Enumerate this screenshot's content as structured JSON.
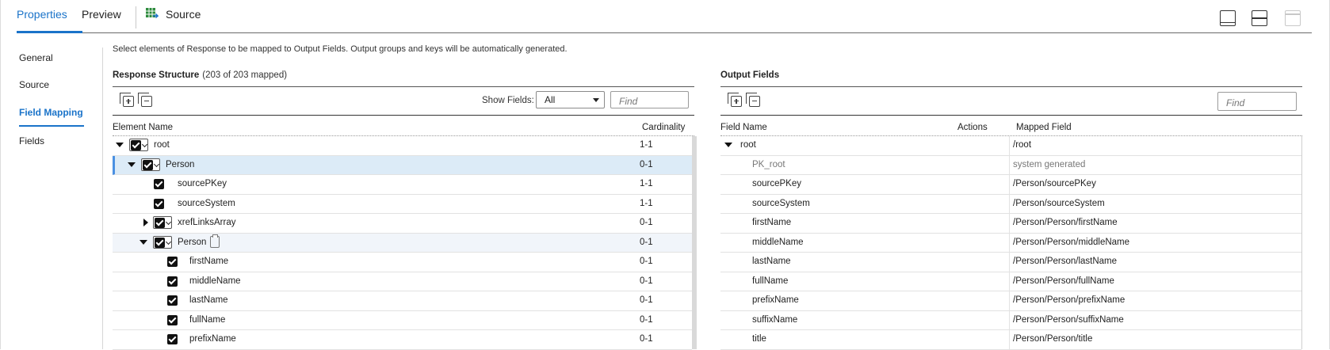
{
  "tabs": [
    {
      "label": "Properties",
      "active": true
    },
    {
      "label": "Preview",
      "active": false
    },
    {
      "label": "Source",
      "active": false
    }
  ],
  "layout_icons": [
    "bottom-panel-icon",
    "split-panel-icon",
    "top-panel-icon"
  ],
  "nav": {
    "items": [
      {
        "label": "General",
        "active": false
      },
      {
        "label": "Source",
        "active": false
      },
      {
        "label": "Field Mapping",
        "active": true
      },
      {
        "label": "Fields",
        "active": false
      }
    ]
  },
  "instruction": "Select elements of Response to be mapped to Output Fields. Output groups and keys will be automatically generated.",
  "response": {
    "title": "Response Structure",
    "mapped": "(203 of 203 mapped)",
    "show_fields_label": "Show Fields:",
    "show_fields_value": "All",
    "find_placeholder": "Find",
    "col_element": "Element Name",
    "col_cardinality": "Cardinality",
    "rows": [
      {
        "name": "root",
        "cardinality": "1-1",
        "level": 0,
        "expander": "down",
        "combo": true
      },
      {
        "name": "Person",
        "cardinality": "0-1",
        "level": 1,
        "expander": "down",
        "combo": true,
        "selected": true
      },
      {
        "name": "sourcePKey",
        "cardinality": "1-1",
        "level": 2,
        "expander": "none",
        "combo": false
      },
      {
        "name": "sourceSystem",
        "cardinality": "1-1",
        "level": 2,
        "expander": "none",
        "combo": false
      },
      {
        "name": "xrefLinksArray",
        "cardinality": "0-1",
        "level": 2,
        "expander": "right",
        "combo": true
      },
      {
        "name": "Person",
        "cardinality": "0-1",
        "level": 2,
        "expander": "down",
        "combo": true,
        "clip": true,
        "hover": true
      },
      {
        "name": "firstName",
        "cardinality": "0-1",
        "level": 3,
        "expander": "none",
        "combo": false
      },
      {
        "name": "middleName",
        "cardinality": "0-1",
        "level": 3,
        "expander": "none",
        "combo": false
      },
      {
        "name": "lastName",
        "cardinality": "0-1",
        "level": 3,
        "expander": "none",
        "combo": false
      },
      {
        "name": "fullName",
        "cardinality": "0-1",
        "level": 3,
        "expander": "none",
        "combo": false
      },
      {
        "name": "prefixName",
        "cardinality": "0-1",
        "level": 3,
        "expander": "none",
        "combo": false
      }
    ]
  },
  "output": {
    "title": "Output Fields",
    "find_placeholder": "Find",
    "col_field": "Field Name",
    "col_actions": "Actions",
    "col_mapped": "Mapped Field",
    "rows": [
      {
        "name": "root",
        "mapped": "/root",
        "group": true
      },
      {
        "name": "PK_root",
        "mapped": "system generated",
        "muted": true
      },
      {
        "name": "sourcePKey",
        "mapped": "/Person/sourcePKey"
      },
      {
        "name": "sourceSystem",
        "mapped": "/Person/sourceSystem"
      },
      {
        "name": "firstName",
        "mapped": "/Person/Person/firstName"
      },
      {
        "name": "middleName",
        "mapped": "/Person/Person/middleName"
      },
      {
        "name": "lastName",
        "mapped": "/Person/Person/lastName"
      },
      {
        "name": "fullName",
        "mapped": "/Person/Person/fullName"
      },
      {
        "name": "prefixName",
        "mapped": "/Person/Person/prefixName"
      },
      {
        "name": "suffixName",
        "mapped": "/Person/Person/suffixName"
      },
      {
        "name": "title",
        "mapped": "/Person/Person/title"
      }
    ]
  },
  "colors": {
    "accent": "#1a73c9",
    "selected_row": "#dcebf7"
  }
}
